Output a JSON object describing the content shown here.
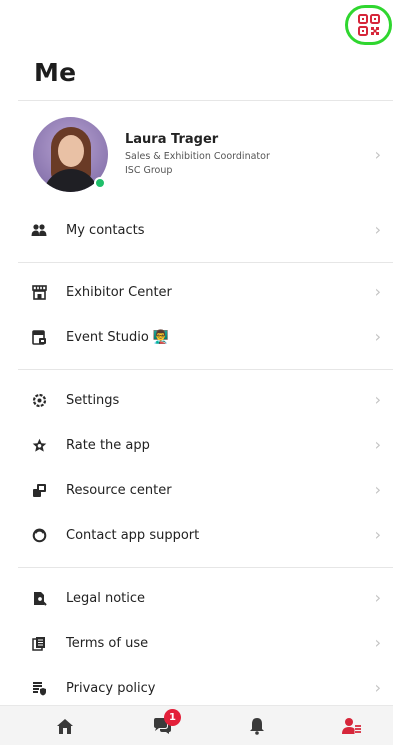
{
  "header": {
    "title": "Me",
    "qr_icon": "qr-code-icon"
  },
  "profile": {
    "name": "Laura Trager",
    "role": "Sales & Exhibition Coordinator",
    "company": "ISC Group",
    "status": "online"
  },
  "menu": [
    {
      "label": "My contacts",
      "icon": "contacts-icon"
    },
    {
      "label": "Exhibitor Center",
      "icon": "store-icon"
    },
    {
      "label": "Event Studio 👨‍🏫",
      "icon": "event-studio-icon"
    },
    {
      "label": "Settings",
      "icon": "gear-icon"
    },
    {
      "label": "Rate the app",
      "icon": "star-icon"
    },
    {
      "label": "Resource center",
      "icon": "resource-icon"
    },
    {
      "label": "Contact app support",
      "icon": "support-icon"
    },
    {
      "label": "Legal notice",
      "icon": "legal-icon"
    },
    {
      "label": "Terms of use",
      "icon": "document-icon"
    },
    {
      "label": "Privacy policy",
      "icon": "privacy-icon"
    }
  ],
  "bottom_nav": {
    "items": [
      {
        "name": "home",
        "icon": "home-icon"
      },
      {
        "name": "messages",
        "icon": "chat-icon",
        "badge": "1"
      },
      {
        "name": "notifications",
        "icon": "bell-icon"
      },
      {
        "name": "profile",
        "icon": "profile-icon",
        "active": true
      }
    ]
  },
  "colors": {
    "accent": "#d6263a",
    "highlight_ring": "#2fd62f",
    "status_online": "#1fbf6a"
  }
}
